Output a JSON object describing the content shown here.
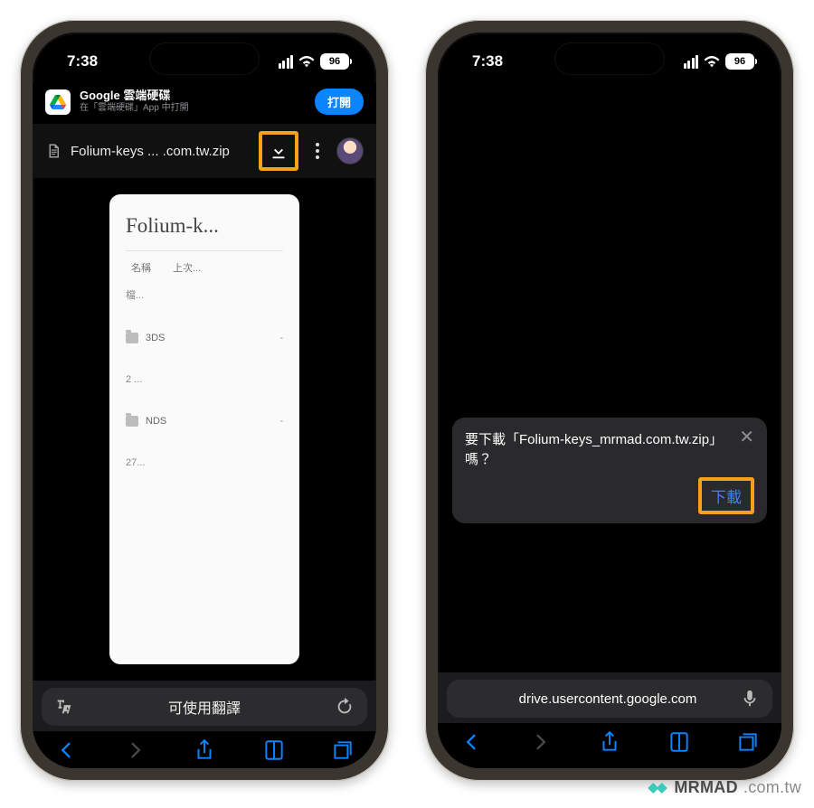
{
  "status": {
    "time": "7:38",
    "battery": "96"
  },
  "left": {
    "banner": {
      "title": "Google 雲端硬碟",
      "subtitle": "在「雲端硬碟」App 中打開",
      "open": "打開"
    },
    "header": {
      "filename": "Folium-keys ... .com.tw.zip"
    },
    "zip": {
      "title": "Folium-k...",
      "col_name": "名稱",
      "col_last": "上次...",
      "rows": [
        {
          "kind": "label",
          "text": "檔..."
        },
        {
          "kind": "folder",
          "text": "3DS",
          "dash": "-"
        },
        {
          "kind": "label",
          "text": "2 ..."
        },
        {
          "kind": "folder",
          "text": "NDS",
          "dash": "-"
        },
        {
          "kind": "label",
          "text": "27..."
        }
      ]
    },
    "translate_bar": "可使用翻譯"
  },
  "right": {
    "popup": {
      "text": "要下載「Folium-keys_mrmad.com.tw.zip」嗎？",
      "action": "下載"
    },
    "url": "drive.usercontent.google.com"
  },
  "watermark": {
    "brand": "MRMAD",
    "suffix": ".com.tw"
  }
}
